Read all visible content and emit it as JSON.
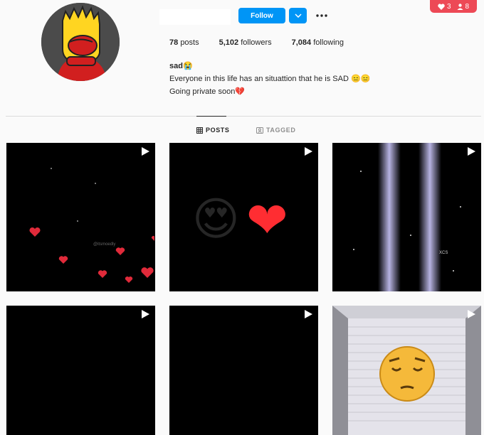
{
  "header": {
    "follow_label": "Follow",
    "notifications": {
      "likes": "3",
      "follows": "8"
    }
  },
  "stats": {
    "posts_count": "78",
    "posts_label": "posts",
    "followers_count": "5,102",
    "followers_label": "followers",
    "following_count": "7,084",
    "following_label": "following"
  },
  "bio": {
    "name": "sad😭",
    "line1": "Everyone in this life has an situattion that he is SAD 😑😑",
    "line2": "Going private soon💔"
  },
  "tabs": [
    {
      "label": "POSTS",
      "active": true
    },
    {
      "label": "TAGGED",
      "active": false
    }
  ],
  "posts": [
    {
      "caption_overlay": "@itsmoedly",
      "is_video": true
    },
    {
      "caption_overlay": "",
      "is_video": true
    },
    {
      "caption_overlay": "XCS",
      "is_video": true
    },
    {
      "caption_overlay": "",
      "is_video": true
    },
    {
      "caption_overlay": "",
      "is_video": true
    },
    {
      "caption_overlay": "",
      "is_video": true
    }
  ],
  "colors": {
    "accent": "#0095f6",
    "notif": "#ed4956",
    "background": "#fafafa"
  }
}
